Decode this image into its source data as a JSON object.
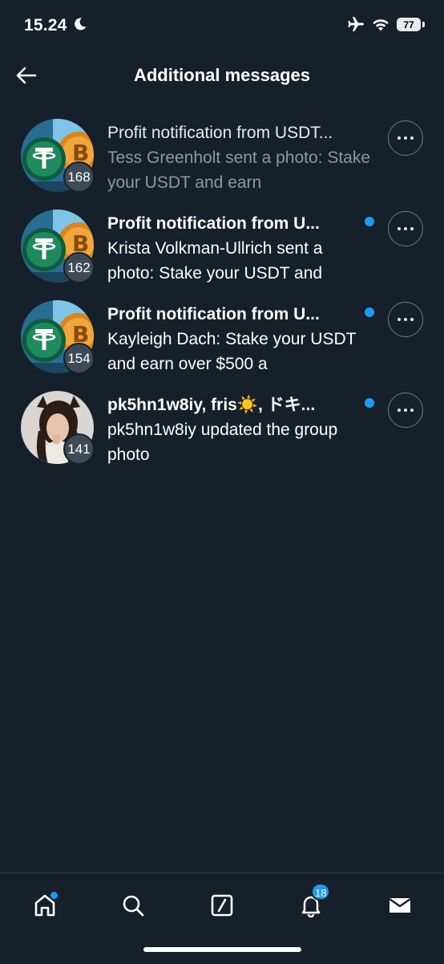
{
  "status_bar": {
    "time": "15.24",
    "battery": "77"
  },
  "header": {
    "title": "Additional messages"
  },
  "conversations": [
    {
      "title": "Profit notification from USDT...",
      "preview": "Tess Greenholt sent a photo: Stake your USDT and earn",
      "count": "168",
      "unread": false
    },
    {
      "title": "Profit notification from U...",
      "preview": "Krista Volkman-Ullrich sent a photo: Stake your USDT and",
      "count": "162",
      "unread": true
    },
    {
      "title": "Profit notification from U...",
      "preview": "Kayleigh Dach: Stake your USDT and earn over $500 a",
      "count": "154",
      "unread": true
    },
    {
      "title": "pk5hn1w8iy, fris☀️, ドキ...",
      "preview": "pk5hn1w8iy updated the group photo",
      "count": "141",
      "unread": true
    }
  ],
  "bottom_nav": {
    "items": [
      "home-icon",
      "search-icon",
      "grok-icon",
      "bell-icon",
      "mail-icon"
    ],
    "notifications_badge": "18"
  },
  "colors": {
    "background": "#15202b",
    "accent": "#1d9bf0",
    "secondary_text": "#8b98a5"
  }
}
